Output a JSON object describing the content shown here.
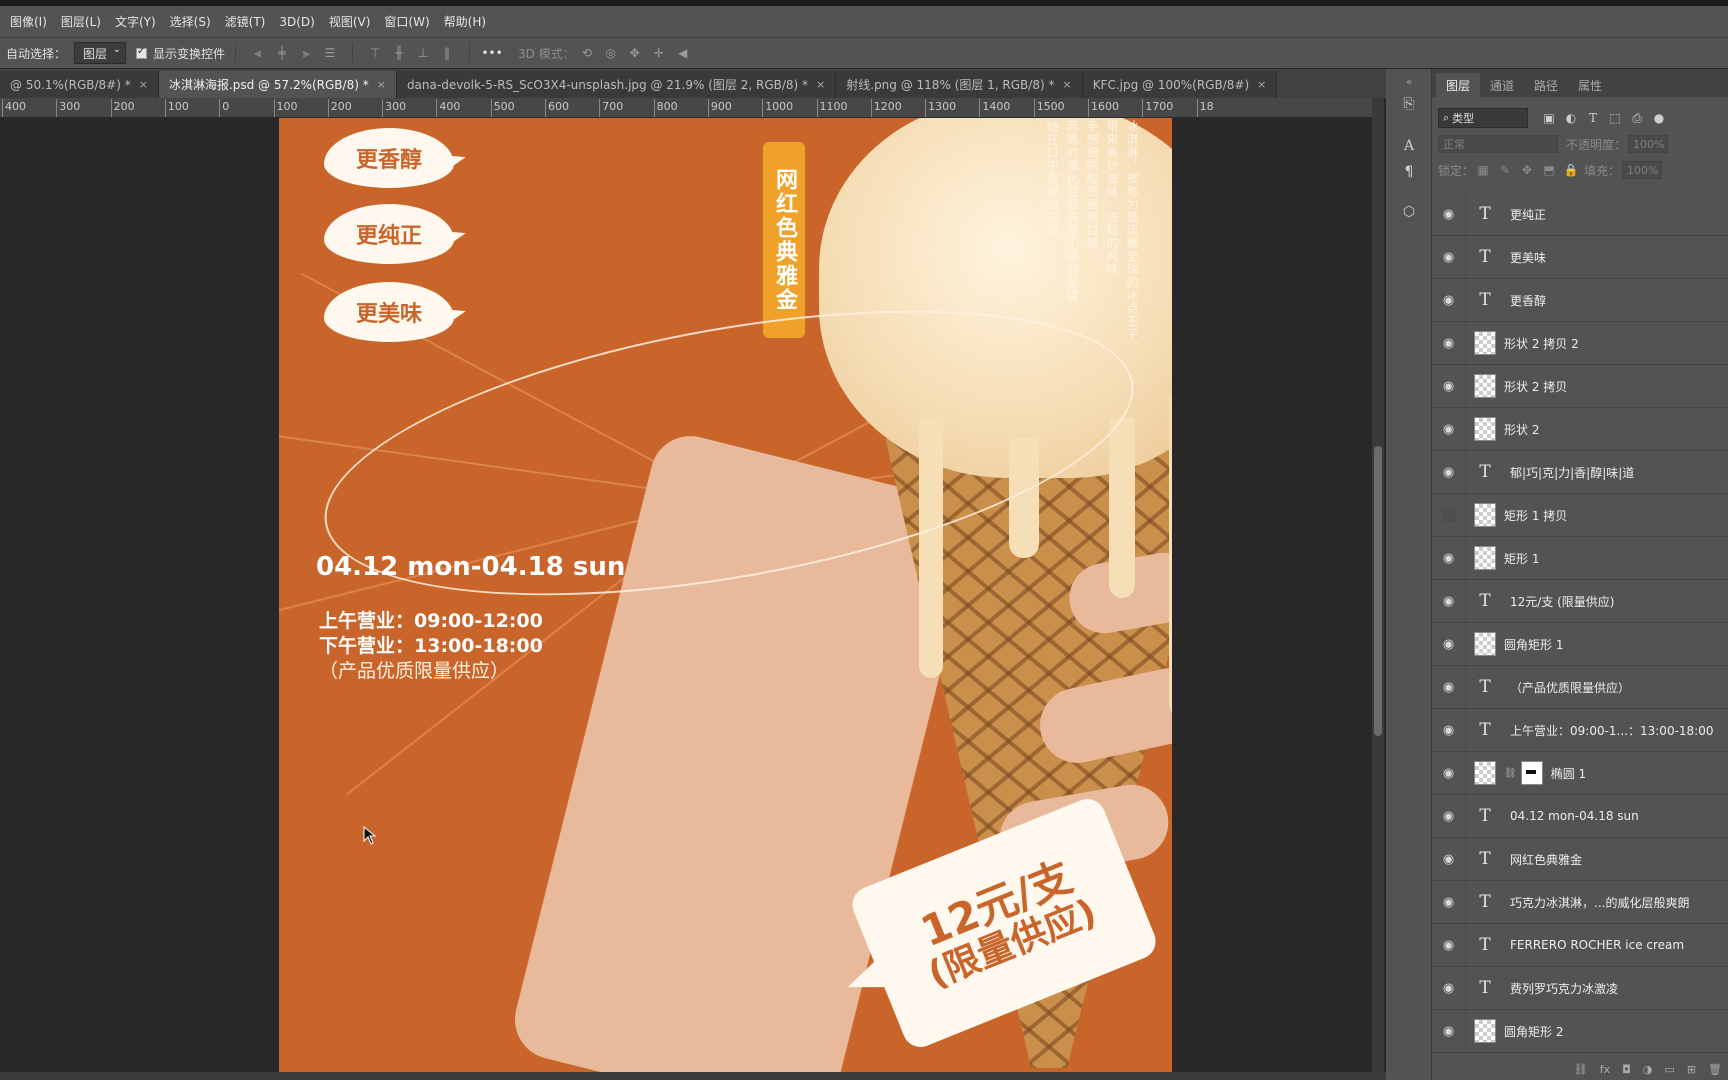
{
  "menubar": [
    "图像(I)",
    "图层(L)",
    "文字(Y)",
    "选择(S)",
    "滤镜(T)",
    "3D(D)",
    "视图(V)",
    "窗口(W)",
    "帮助(H)"
  ],
  "options": {
    "auto_select_label": "自动选择：",
    "auto_select_value": "图层",
    "show_transform_label": "显示变换控件",
    "mode_3d_label": "3D 模式："
  },
  "tabs": [
    {
      "label": "@ 50.1%(RGB/8#) *",
      "active": false
    },
    {
      "label": "冰淇淋海报.psd @ 57.2%(RGB/8) *",
      "active": true
    },
    {
      "label": "dana-devolk-5-RS_ScO3X4-unsplash.jpg @ 21.9% (图层 2, RGB/8) *",
      "active": false
    },
    {
      "label": "射线.png @ 118% (图层 1, RGB/8) *",
      "active": false
    },
    {
      "label": "KFC.jpg @ 100%(RGB/8#)",
      "active": false
    }
  ],
  "ruler": [
    "400",
    "300",
    "200",
    "100",
    "0",
    "100",
    "200",
    "300",
    "400",
    "500",
    "600",
    "700",
    "800",
    "900",
    "1000",
    "1100",
    "1200",
    "1300",
    "1400",
    "1500",
    "1600",
    "1700",
    "18"
  ],
  "poster": {
    "bubbles": [
      "更香醇",
      "更纯正",
      "更美味"
    ],
    "vertical_tag": "网红色典雅金",
    "vertical_copy": [
      "冰淇淋，被称为是风靡全球的冰点王子。",
      "带来美妙滋味，浓郁的风味",
      "手感细腻般的细滑口感",
      "而脆的威化层般爽朗不腻的豪情",
      "她在口中浓郁的味道"
    ],
    "date": "04.12 mon-04.18 sun",
    "hours_am": "上午营业：09:00-12:00",
    "hours_pm": "下午营业：13:00-18:00",
    "note": "（产品优质限量供应）",
    "price_main": "12元/支",
    "price_sub": "(限量供应)"
  },
  "panel": {
    "tabs": [
      "图层",
      "通道",
      "路径",
      "属性"
    ],
    "filter_label": "类型",
    "blend_mode": "正常",
    "opacity_label": "不透明度：",
    "opacity_value": "100%",
    "lock_label": "锁定：",
    "fill_label": "填充：",
    "fill_value": "100%",
    "layers": [
      {
        "type": "text",
        "name": "更纯正",
        "visible": true
      },
      {
        "type": "text",
        "name": "更美味",
        "visible": true
      },
      {
        "type": "text",
        "name": "更香醇",
        "visible": true
      },
      {
        "type": "shape",
        "name": "形状 2 拷贝 2",
        "visible": true
      },
      {
        "type": "shape",
        "name": "形状 2 拷贝",
        "visible": true
      },
      {
        "type": "shape",
        "name": "形状 2",
        "visible": true
      },
      {
        "type": "text",
        "name": "郁|巧|克|力|香|醇|味|道",
        "visible": true
      },
      {
        "type": "shape",
        "name": "矩形 1 拷贝",
        "visible": false
      },
      {
        "type": "shape",
        "name": "矩形 1",
        "visible": true
      },
      {
        "type": "text",
        "name": "12元/支 (限量供应)",
        "visible": true
      },
      {
        "type": "shape",
        "name": "圆角矩形 1",
        "visible": true
      },
      {
        "type": "text",
        "name": "（产品优质限量供应）",
        "visible": true
      },
      {
        "type": "text",
        "name": "上午营业：09:00-1...：13:00-18:00",
        "visible": true
      },
      {
        "type": "masked",
        "name": "椭圆 1",
        "visible": true
      },
      {
        "type": "text",
        "name": "04.12 mon-04.18 sun",
        "visible": true
      },
      {
        "type": "text",
        "name": "网红色典雅金",
        "visible": true
      },
      {
        "type": "text",
        "name": "巧克力冰淇淋，...的威化层般爽朗",
        "visible": true
      },
      {
        "type": "text",
        "name": "FERRERO ROCHER ice cream",
        "visible": true
      },
      {
        "type": "text",
        "name": "费列罗巧克力冰激凌",
        "visible": true
      },
      {
        "type": "shape",
        "name": "圆角矩形 2",
        "visible": true
      }
    ]
  },
  "colors": {
    "poster_bg": "#c9652a",
    "tag": "#f0a12a",
    "panel": "#535353"
  }
}
